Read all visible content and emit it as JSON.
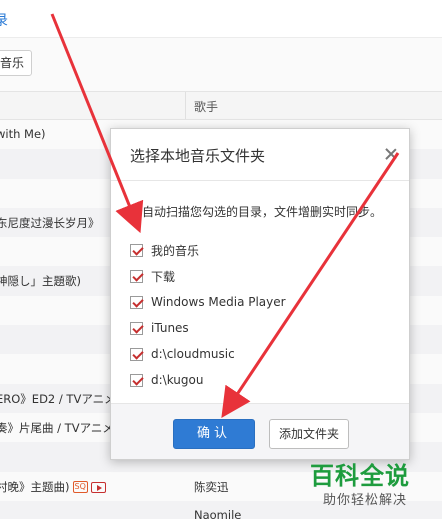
{
  "background": {
    "top_link": "录",
    "button_label": "音乐",
    "column_artist": "歌手",
    "rows": [
      {
        "title": "with Me)",
        "artist": "",
        "sq": false,
        "mv": false
      },
      {
        "title": "",
        "artist": "",
        "sq": false,
        "mv": false
      },
      {
        "title": "",
        "artist": "",
        "sq": false,
        "mv": false
      },
      {
        "title": "东尼度过漫长岁月》",
        "artist": "",
        "sq": false,
        "mv": false
      },
      {
        "title": "",
        "artist": "",
        "sq": false,
        "mv": false
      },
      {
        "title": "神隠し」主題歌)",
        "artist": "",
        "sq": false,
        "mv": false
      },
      {
        "title": "",
        "artist": "",
        "sq": false,
        "mv": false
      },
      {
        "title": "",
        "artist": "",
        "sq": false,
        "mv": false
      },
      {
        "title": "",
        "artist": "",
        "sq": false,
        "mv": false
      },
      {
        "title": "ERO》ED2 / TVアニメ",
        "artist": "",
        "sq": false,
        "mv": false
      },
      {
        "title": "奏》片尾曲 / TVアニメ",
        "artist": "",
        "sq": false,
        "mv": false
      },
      {
        "title": "",
        "artist": "",
        "sq": false,
        "mv": false
      },
      {
        "title": "村晚》主题曲)",
        "artist": "陈奕迅",
        "sq": true,
        "mv": true
      },
      {
        "title": "",
        "artist": "Naomile",
        "sq": false,
        "mv": false
      }
    ],
    "sq_label": "SQ"
  },
  "dialog": {
    "title": "选择本地音乐文件夹",
    "description": "将自动扫描您勾选的目录，文件增删实时同步。",
    "folders": [
      {
        "label": "我的音乐",
        "checked": true
      },
      {
        "label": "下载",
        "checked": true
      },
      {
        "label": "Windows Media Player",
        "checked": true
      },
      {
        "label": "iTunes",
        "checked": true
      },
      {
        "label": "d:\\cloudmusic",
        "checked": true
      },
      {
        "label": "d:\\kugou",
        "checked": true
      }
    ],
    "confirm_label": "确认",
    "add_folder_label": "添加文件夹"
  },
  "colors": {
    "accent": "#2f7bd4",
    "check": "#c62f2f",
    "arrow": "#e8323a",
    "watermark": "#1e9c3e"
  },
  "watermark": {
    "title": "百科全说",
    "subtitle": "助你轻松解决"
  }
}
